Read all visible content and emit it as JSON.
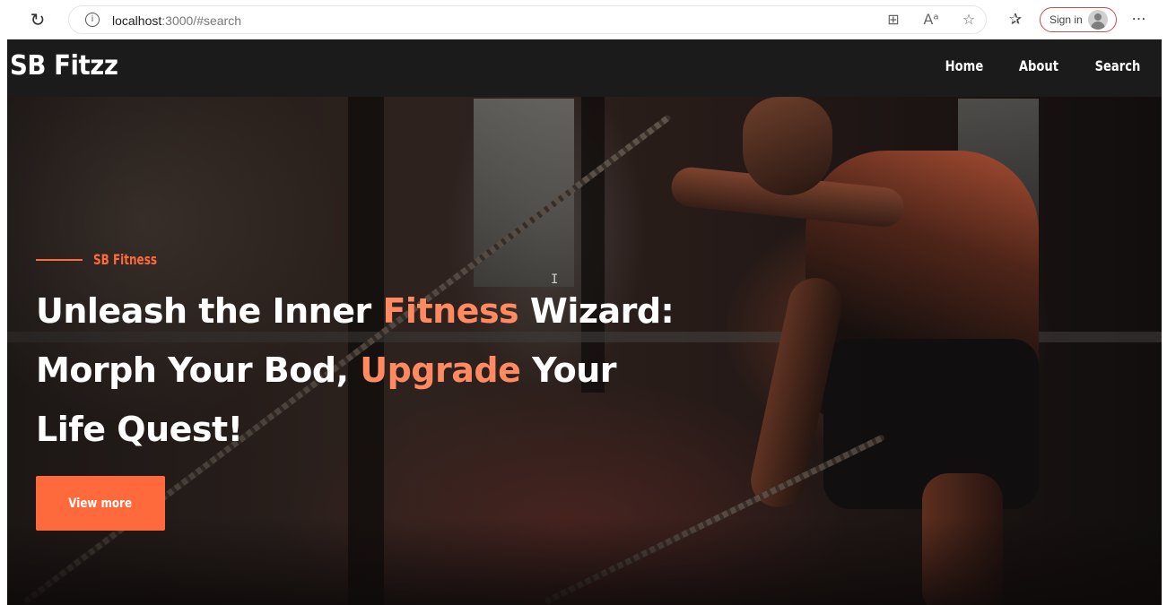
{
  "browser": {
    "url_host": "localhost",
    "url_path": ":3000/#search",
    "sign_in_label": "Sign in",
    "icons": [
      "reload-icon",
      "info-icon",
      "app-grid-icon",
      "read-aloud-icon",
      "favorite-star-icon",
      "favorites-bar-icon",
      "profile-avatar-icon",
      "more-menu-icon"
    ]
  },
  "site": {
    "brand": "SB Fitzz",
    "nav": [
      {
        "label": "Home"
      },
      {
        "label": "About"
      },
      {
        "label": "Search"
      }
    ]
  },
  "hero": {
    "eyebrow": "SB Fitness",
    "line1_a": "Unleash the Inner ",
    "line1_accent": "Fitness",
    "line1_b": " Wizard:",
    "line2_a": "Morph Your Bod, ",
    "line2_accent": "Upgrade",
    "line2_b": " Your",
    "line3": "Life Quest!",
    "cta_label": "View more"
  },
  "colors": {
    "accent": "#ff6a3d",
    "accent_text": "#ff8a62",
    "navbar_bg": "#1b1b1b",
    "text": "#ffffff"
  }
}
